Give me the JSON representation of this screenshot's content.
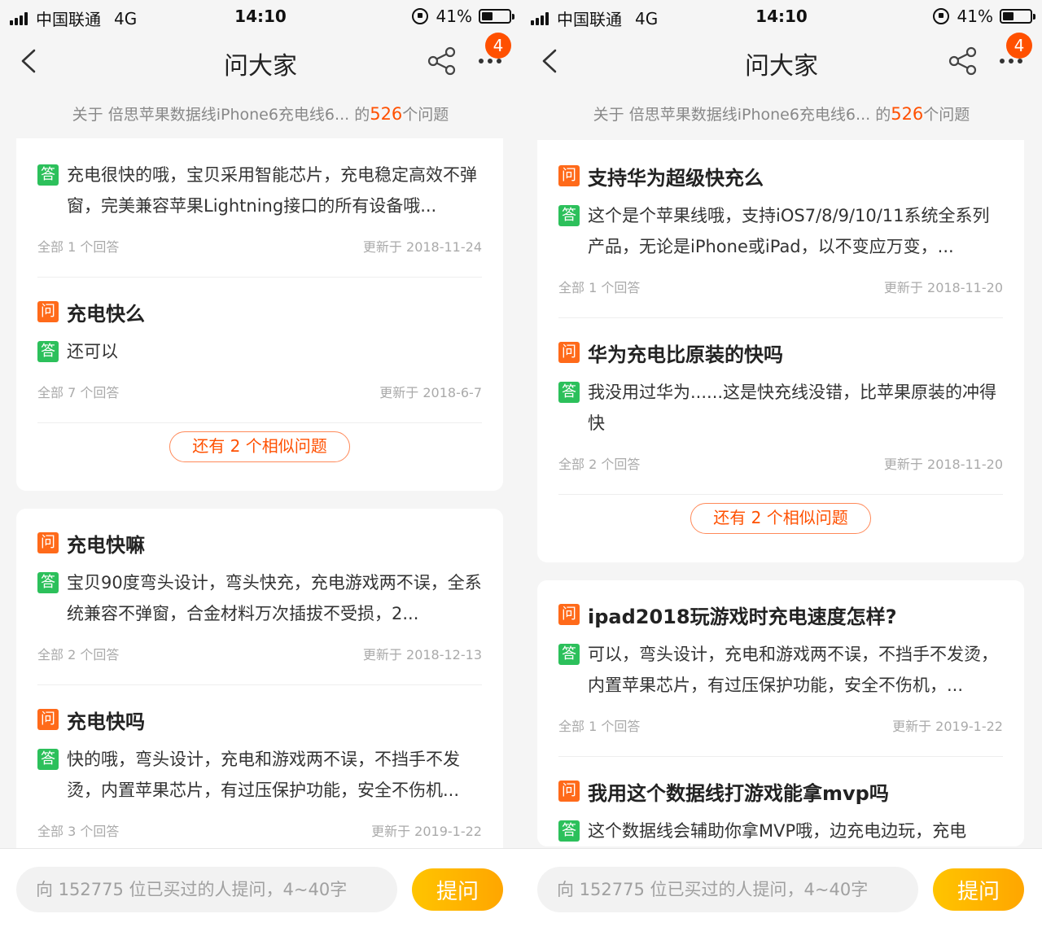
{
  "screens": [
    {
      "status": {
        "carrier": "中国联通",
        "network": "4G",
        "time": "14:10",
        "battery": "41%"
      },
      "nav": {
        "title": "问大家",
        "badge": "4"
      },
      "subheader": {
        "prefix": "关于 倍思苹果数据线iPhone6充电线6...",
        "of": " 的",
        "count": "526",
        "suffix": "个问题"
      },
      "cards": [
        {
          "items": [
            {
              "question": "",
              "answer": "充电很快的哦，宝贝采用智能芯片，充电稳定高效不弹窗，完美兼容苹果Lightning接口的所有设备哦...",
              "count": "全部 1 个回答",
              "updated": "更新于 2018-11-24"
            },
            {
              "question": "充电快么",
              "answer": "还可以",
              "count": "全部 7 个回答",
              "updated": "更新于 2018-6-7"
            }
          ],
          "more": "还有 2 个相似问题"
        },
        {
          "items": [
            {
              "question": "充电快嘛",
              "answer": "宝贝90度弯头设计，弯头快充，充电游戏两不误，全系统兼容不弹窗，合金材料万次插拔不受损，2...",
              "count": "全部 2 个回答",
              "updated": "更新于 2018-12-13"
            },
            {
              "question": "充电快吗",
              "answer": "快的哦，弯头设计，充电和游戏两不误，不挡手不发烫，内置苹果芯片，有过压保护功能，安全不伤机...",
              "count": "全部 3 个回答",
              "updated": "更新于 2019-1-22"
            }
          ]
        }
      ],
      "bottom": {
        "placeholder": "向 152775 位已买过的人提问，4~40字",
        "button": "提问"
      }
    },
    {
      "status": {
        "carrier": "中国联通",
        "network": "4G",
        "time": "14:10",
        "battery": "41%"
      },
      "nav": {
        "title": "问大家",
        "badge": "4"
      },
      "subheader": {
        "prefix": "关于 倍思苹果数据线iPhone6充电线6...",
        "of": " 的",
        "count": "526",
        "suffix": "个问题"
      },
      "cards": [
        {
          "items": [
            {
              "question": "支持华为超级快充么",
              "answer": "这个是个苹果线哦，支持iOS7/8/9/10/11系统全系列产品，无论是iPhone或iPad，以不变应万变，...",
              "count": "全部 1 个回答",
              "updated": "更新于 2018-11-20"
            },
            {
              "question": "华为充电比原装的快吗",
              "answer": "我没用过华为......这是快充线没错，比苹果原装的冲得快",
              "count": "全部 2 个回答",
              "updated": "更新于 2018-11-20"
            }
          ],
          "more": "还有 2 个相似问题"
        },
        {
          "items": [
            {
              "question": "ipad2018玩游戏时充电速度怎样?",
              "answer": "可以，弯头设计，充电和游戏两不误，不挡手不发烫，内置苹果芯片，有过压保护功能，安全不伤机，...",
              "count": "全部 1 个回答",
              "updated": "更新于 2019-1-22"
            },
            {
              "question": "我用这个数据线打游戏能拿mvp吗",
              "answer": "这个数据线会辅助你拿MVP哦，边充电边玩，充电",
              "count": "",
              "updated": ""
            }
          ]
        }
      ],
      "bottom": {
        "placeholder": "向 152775 位已买过的人提问，4~40字",
        "button": "提问"
      }
    }
  ],
  "labels": {
    "question_tag": "问",
    "answer_tag": "答"
  },
  "colors": {
    "accent": "#ff5000",
    "question_tag": "#ff6a1a",
    "answer_tag": "#2cc05b",
    "ask_button": "#ffb300"
  },
  "icons": [
    "signal-icon",
    "lock-rotation-icon",
    "battery-icon",
    "back-icon",
    "share-icon",
    "more-icon"
  ]
}
